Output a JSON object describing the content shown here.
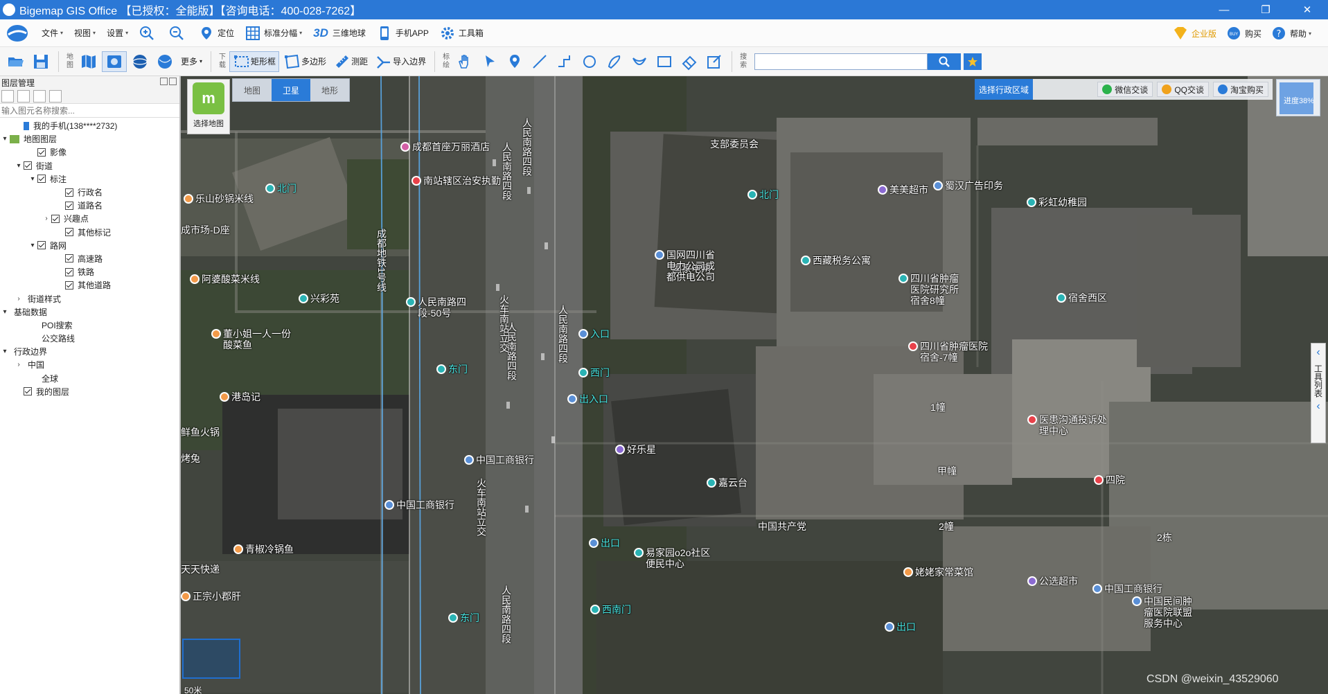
{
  "window": {
    "title": "Bigemap GIS Office 【已授权：全能版】【咨询电话：400-028-7262】",
    "minimize": "—",
    "maximize": "❐",
    "close": "✕"
  },
  "menubar": {
    "items": [
      {
        "label": "文件",
        "caret": "▾"
      },
      {
        "label": "视图",
        "caret": "▾"
      },
      {
        "label": "设置",
        "caret": "▾"
      }
    ],
    "tools": [
      {
        "label": "定位",
        "icon": "location-pin-icon"
      },
      {
        "label": "标准分幅",
        "caret": "▾",
        "icon": "grid-icon"
      },
      {
        "label": "三维地球",
        "prefix": "3D",
        "icon": "3d-icon"
      },
      {
        "label": "手机APP",
        "icon": "phone-icon"
      },
      {
        "label": "工具箱",
        "icon": "gear-icon"
      }
    ],
    "right": [
      {
        "label": "企业版",
        "icon": "vip-icon"
      },
      {
        "label": "购买",
        "icon": "buy-icon"
      },
      {
        "label": "帮助",
        "caret": "▾",
        "icon": "help-icon"
      }
    ]
  },
  "toolbar": {
    "map_label": "地图",
    "more_label": "更多",
    "download_label": "下载",
    "rect_label": "矩形框",
    "polygon_label": "多边形",
    "measure_label": "测距",
    "import_label": "导入边界",
    "mark_label": "标绘",
    "search_label": "搜索",
    "search_value": ""
  },
  "layer_panel": {
    "title": "图层管理",
    "search_placeholder": "输入图元名称搜索...",
    "tree": [
      {
        "label": "我的手机(138****2732)",
        "indent": 1,
        "toggle": "",
        "check": null,
        "icon": "phone"
      },
      {
        "label": "地图图层",
        "indent": 0,
        "toggle": "▾",
        "check": null,
        "icon": "layer"
      },
      {
        "label": "影像",
        "indent": 2,
        "toggle": "",
        "check": true
      },
      {
        "label": "街道",
        "indent": 1,
        "toggle": "▾",
        "check": true
      },
      {
        "label": "标注",
        "indent": 2,
        "toggle": "▾",
        "check": true
      },
      {
        "label": "行政名",
        "indent": 4,
        "toggle": "",
        "check": true
      },
      {
        "label": "道路名",
        "indent": 4,
        "toggle": "",
        "check": true
      },
      {
        "label": "兴趣点",
        "indent": 3,
        "toggle": "›",
        "check": true
      },
      {
        "label": "其他标记",
        "indent": 4,
        "toggle": "",
        "check": true
      },
      {
        "label": "路网",
        "indent": 2,
        "toggle": "▾",
        "check": true
      },
      {
        "label": "高速路",
        "indent": 4,
        "toggle": "",
        "check": true
      },
      {
        "label": "铁路",
        "indent": 4,
        "toggle": "",
        "check": true
      },
      {
        "label": "其他道路",
        "indent": 4,
        "toggle": "",
        "check": true
      },
      {
        "label": "街道样式",
        "indent": 1,
        "toggle": "›",
        "check": null
      },
      {
        "label": "基础数据",
        "indent": 0,
        "toggle": "▾",
        "check": null
      },
      {
        "label": "POI搜索",
        "indent": 2,
        "toggle": "",
        "check": null
      },
      {
        "label": "公交路线",
        "indent": 2,
        "toggle": "",
        "check": null
      },
      {
        "label": "行政边界",
        "indent": 0,
        "toggle": "▾",
        "check": null
      },
      {
        "label": "中国",
        "indent": 1,
        "toggle": "›",
        "check": null
      },
      {
        "label": "全球",
        "indent": 2,
        "toggle": "",
        "check": null
      },
      {
        "label": "我的图层",
        "indent": 1,
        "toggle": "",
        "check": true
      }
    ]
  },
  "map": {
    "tabs": [
      "地图",
      "卫星",
      "地形"
    ],
    "active_tab": "卫星",
    "choose_map_label": "选择地图",
    "region_label": "选择行政区域",
    "links": [
      "微信交谈",
      "QQ交谈",
      "淘宝购买"
    ],
    "progress_label": "进度38%",
    "progress_value": 0.38,
    "side_tool_label": "工具列表",
    "scale_label": "50米",
    "watermark": "CSDN @weixin_43529060",
    "pois": [
      {
        "name": "成都首座万丽酒店",
        "type": "hotel",
        "color": "#d35fa6"
      },
      {
        "name": "南站辖区治安执勤",
        "type": "police",
        "color": "#e8414a"
      },
      {
        "name": "北门",
        "type": "gate",
        "color": "#2ab3b4"
      },
      {
        "name": "乐山砂锅米线",
        "type": "food",
        "color": "#f39a49"
      },
      {
        "name": "成市场-D座",
        "type": "label",
        "color": ""
      },
      {
        "name": "阿婆酸菜米线",
        "type": "food",
        "color": "#f39a49"
      },
      {
        "name": "兴彩苑",
        "type": "residence",
        "color": "#2ab3b4"
      },
      {
        "name": "人民南路四段-50号",
        "type": "residence",
        "color": "#2ab3b4"
      },
      {
        "name": "董小姐一人一份酸菜鱼",
        "type": "food",
        "color": "#f39a49"
      },
      {
        "name": "东门",
        "type": "gate",
        "color": "#2ab3b4"
      },
      {
        "name": "港岛记",
        "type": "food",
        "color": "#f39a49"
      },
      {
        "name": "鲜鱼火锅",
        "type": "label",
        "color": ""
      },
      {
        "name": "烤兔",
        "type": "label",
        "color": ""
      },
      {
        "name": "中国工商银行",
        "type": "bank",
        "color": "#5a8fd6"
      },
      {
        "name": "中国工商银行",
        "type": "bank",
        "color": "#5a8fd6"
      },
      {
        "name": "青椒冷锅鱼",
        "type": "food",
        "color": "#f39a49"
      },
      {
        "name": "天天快递",
        "type": "label",
        "color": ""
      },
      {
        "name": "正宗小郡肝",
        "type": "food",
        "color": "#f39a49"
      },
      {
        "name": "东门",
        "type": "gate",
        "color": "#2ab3b4"
      },
      {
        "name": "支部委员会",
        "type": "label",
        "color": ""
      },
      {
        "name": "国家电网",
        "type": "label",
        "color": ""
      },
      {
        "name": "国网四川省电力公司成都供电公司",
        "type": "company",
        "color": "#5a8fd6"
      },
      {
        "name": "北门",
        "type": "gate",
        "color": "#2ab3b4"
      },
      {
        "name": "美美超市",
        "type": "shop",
        "color": "#8b6ad2"
      },
      {
        "name": "蜀汉广告印务",
        "type": "company",
        "color": "#5a8fd6"
      },
      {
        "name": "彩虹幼稚园",
        "type": "school",
        "color": "#2ab3b4"
      },
      {
        "name": "西藏税务公寓",
        "type": "residence",
        "color": "#2ab3b4"
      },
      {
        "name": "四川省肿瘤医院研究所宿舍8幢",
        "type": "residence",
        "color": "#2ab3b4"
      },
      {
        "name": "宿舍西区",
        "type": "residence",
        "color": "#2ab3b4"
      },
      {
        "name": "入口",
        "type": "parking",
        "color": "#5a8fd6"
      },
      {
        "name": "西门",
        "type": "gate",
        "color": "#2ab3b4"
      },
      {
        "name": "出入口",
        "type": "parking",
        "color": "#5a8fd6"
      },
      {
        "name": "四川省肿瘤医院宿舍-7幢",
        "type": "hospital",
        "color": "#e8414a"
      },
      {
        "name": "1幢",
        "type": "label",
        "color": ""
      },
      {
        "name": "医患沟通投诉处理中心",
        "type": "police",
        "color": "#e8414a"
      },
      {
        "name": "好乐星",
        "type": "shop",
        "color": "#8b6ad2"
      },
      {
        "name": "甲幢",
        "type": "label",
        "color": ""
      },
      {
        "name": "嘉云台",
        "type": "residence",
        "color": "#2ab3b4"
      },
      {
        "name": "四院",
        "type": "hospital",
        "color": "#e8414a"
      },
      {
        "name": "中国共产党",
        "type": "label",
        "color": ""
      },
      {
        "name": "2幢",
        "type": "label",
        "color": ""
      },
      {
        "name": "2栋",
        "type": "label",
        "color": ""
      },
      {
        "name": "出口",
        "type": "parking",
        "color": "#5a8fd6"
      },
      {
        "name": "易家园o2o社区便民中心",
        "type": "company",
        "color": "#2ab3b4"
      },
      {
        "name": "姥姥家常菜馆",
        "type": "food",
        "color": "#f39a49"
      },
      {
        "name": "公选超市",
        "type": "shop",
        "color": "#8b6ad2"
      },
      {
        "name": "西南门",
        "type": "gate",
        "color": "#2ab3b4"
      },
      {
        "name": "中国工商银行",
        "type": "bank",
        "color": "#5a8fd6"
      },
      {
        "name": "出口",
        "type": "parking",
        "color": "#5a8fd6"
      },
      {
        "name": "中国民间肿瘤医院联盟服务中心",
        "type": "company",
        "color": "#5a8fd6"
      }
    ],
    "streets": [
      "人民南路四段",
      "人民南路四段",
      "人民南路四段",
      "人民南路四段",
      "人民南路四段",
      "火车南站立交",
      "火车南站立交",
      "成都地铁1号线"
    ]
  }
}
